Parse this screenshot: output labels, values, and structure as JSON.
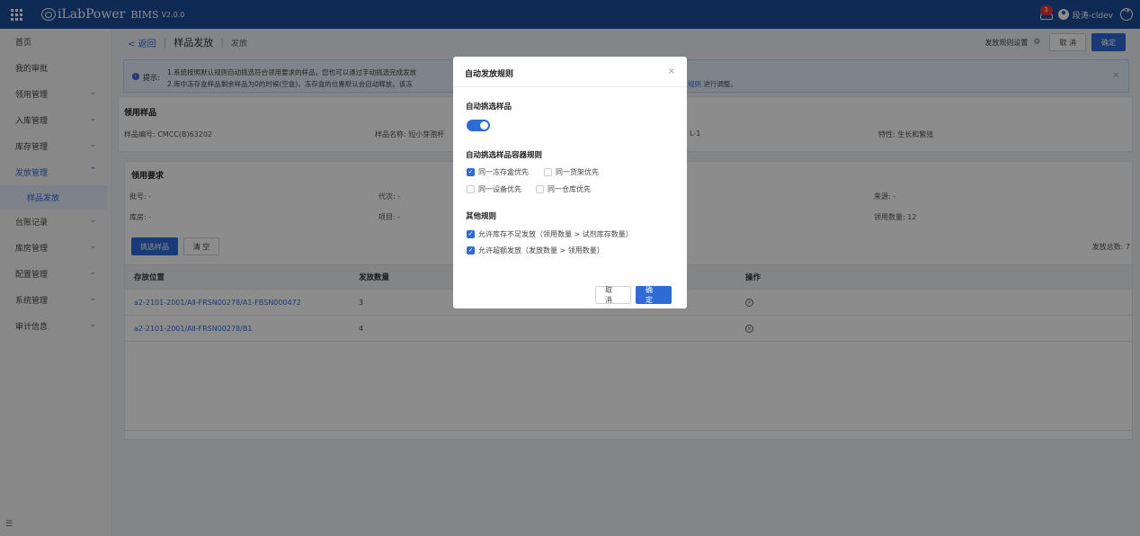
{
  "topbar": {
    "app_name": "iLabPower",
    "app_sub": "BIMS",
    "version": "V2.0.0",
    "notification_count": "3",
    "username": "段涛-cldev"
  },
  "sidebar": {
    "items": [
      {
        "label": "首页"
      },
      {
        "label": "我的审批"
      },
      {
        "label": "领用管理"
      },
      {
        "label": "入库管理"
      },
      {
        "label": "库存管理"
      },
      {
        "label": "发放管理"
      },
      {
        "label": "样品发放"
      },
      {
        "label": "台账记录"
      },
      {
        "label": "库房管理"
      },
      {
        "label": "配置管理"
      },
      {
        "label": "系统管理"
      },
      {
        "label": "审计信息"
      }
    ]
  },
  "header": {
    "back": "< 返回",
    "title": "样品发放",
    "subtitle": "发放",
    "rule_settings": "发放规则设置",
    "cancel": "取 消",
    "confirm": "确定"
  },
  "alert": {
    "label": "提示:",
    "line1": "1.系统按照默认规则自动挑选符合领用要求的样品。您也可以通过手动挑选完成发放",
    "line2": "2.库中冻存盒样品剩余样品为0的时候(空盒)，冻存盒的位置默认会自动释放。该冻",
    "tail_link": "规则",
    "tail_text": " 进行调整。"
  },
  "sample_card": {
    "title": "领用样品",
    "code": "样品编号: CMCC(B)63202",
    "name": "样品名称: 短小芽孢杆",
    "level": "L-1",
    "trait": "特性: 生长和繁殖"
  },
  "request_card": {
    "title": "领用要求",
    "batch": "批号: -",
    "generation": "代次: -",
    "source": "来源: -",
    "room": "库房: -",
    "project": "项目: -",
    "qty": "领用数量: 12",
    "pick_button": "挑选样品",
    "clear_button": "清 空",
    "total": "发放总数: 7"
  },
  "table": {
    "headers": [
      "存放位置",
      "发放数量",
      "操作"
    ],
    "rows": [
      {
        "location": "a2-2101-2001/AⅡ-FRSN00278/A1-FBSN000472",
        "qty": "3"
      },
      {
        "location": "a2-2101-2001/AⅡ-FRSN00278/B1",
        "qty": "4"
      }
    ]
  },
  "modal": {
    "title": "自动发放规则",
    "auto_pick_title": "自动挑选样品",
    "auto_pick_on": true,
    "container_rule_title": "自动挑选样品容器规则",
    "container_rules": [
      {
        "label": "同一冻存盒优先",
        "checked": true
      },
      {
        "label": "同一货架优先",
        "checked": false
      },
      {
        "label": "同一设备优先",
        "checked": false
      },
      {
        "label": "同一仓库优先",
        "checked": false
      }
    ],
    "other_title": "其他规则",
    "other_rules": [
      {
        "label": "允许库存不足发放（领用数量 > 试剂库存数量）",
        "checked": true
      },
      {
        "label": "允许超额发放（发放数量 > 领用数量）",
        "checked": true
      }
    ],
    "cancel": "取 消",
    "confirm": "确 定"
  },
  "colors": {
    "topbar": "#1d4b9b",
    "accent": "#2f6bd4",
    "overlay": "rgba(0,0,0,0.45)"
  }
}
